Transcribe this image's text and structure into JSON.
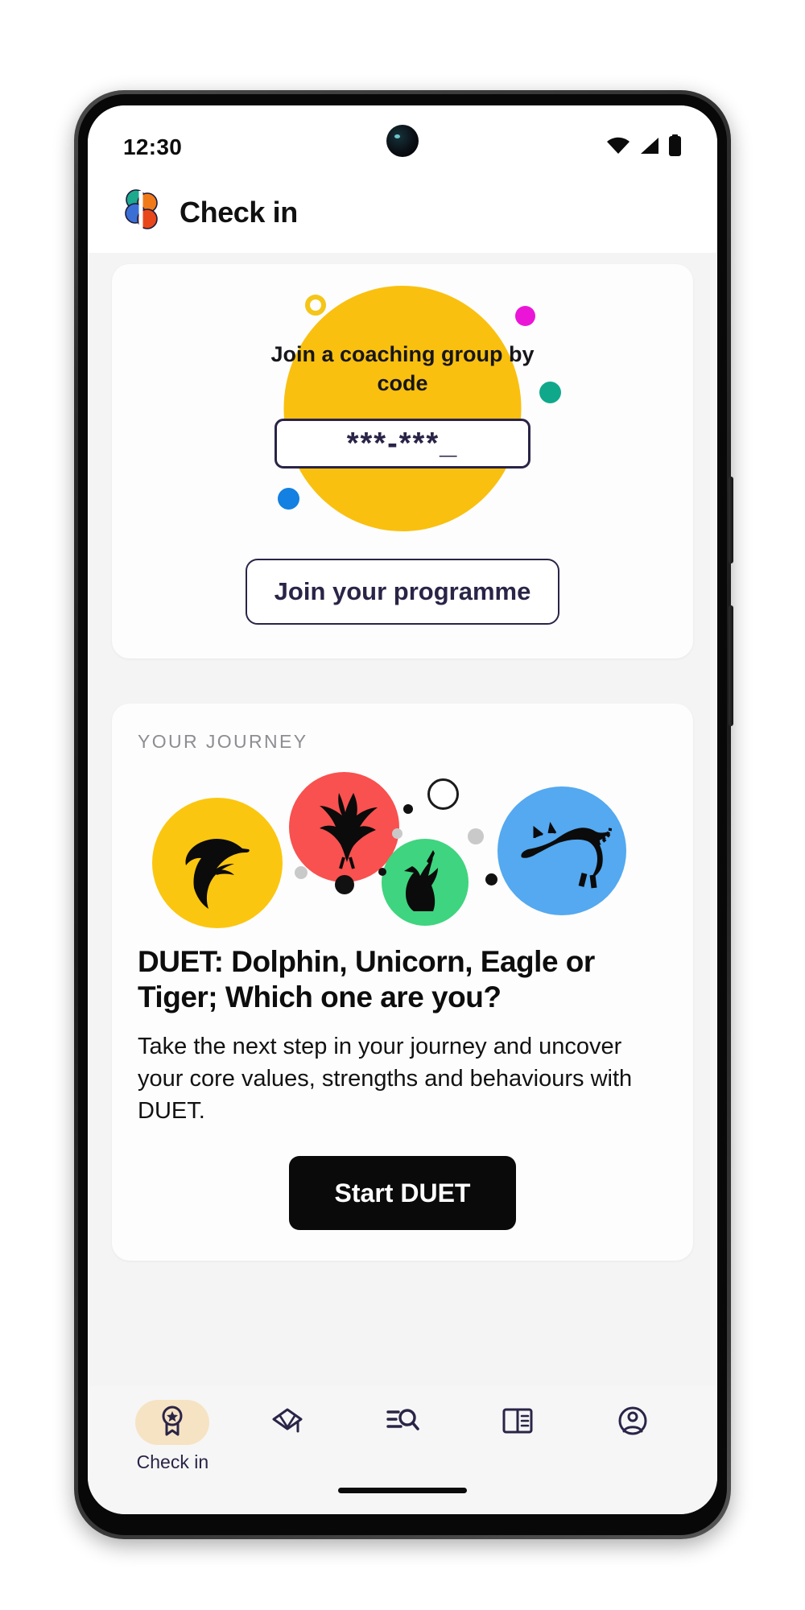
{
  "status_bar": {
    "time": "12:30",
    "icons": [
      "wifi-icon",
      "cellular-signal-icon",
      "battery-icon"
    ]
  },
  "header": {
    "title": "Check in",
    "logo": "app-logo-icon",
    "logo_colors": [
      "#1CA98D",
      "#F07A1A",
      "#3B6FD4",
      "#E8471C"
    ]
  },
  "join_card": {
    "blob_text": "Join a coaching group by code",
    "code_value": "***-***_",
    "code_placeholder": "***-***_",
    "button_label": "Join your programme",
    "blob_color": "#FAC00F",
    "decorations": [
      {
        "name": "deco-ring-yellow",
        "color": "#F5C518",
        "style": "ring"
      },
      {
        "name": "deco-dot-magenta",
        "color": "#EB15D8",
        "style": "solid"
      },
      {
        "name": "deco-dot-teal",
        "color": "#10A88B",
        "style": "solid"
      },
      {
        "name": "deco-dot-blue",
        "color": "#1380E2",
        "style": "solid"
      }
    ]
  },
  "journey_card": {
    "kicker": "YOUR JOURNEY",
    "title": "DUET: Dolphin, Unicorn, Eagle or Tiger; Which one are you?",
    "body": "Take the next step in your journey and uncover your core values, strengths and behaviours with DUET.",
    "button_label": "Start DUET",
    "animals": [
      {
        "name": "dolphin",
        "color": "#FBC60F"
      },
      {
        "name": "eagle",
        "color": "#F8514F"
      },
      {
        "name": "unicorn",
        "color": "#3FD47F"
      },
      {
        "name": "tiger",
        "color": "#54A9F0"
      }
    ]
  },
  "bottom_nav": {
    "items": [
      {
        "label": "Check in",
        "icon": "award-ribbon-icon",
        "active": true
      },
      {
        "label": "",
        "icon": "graduation-cap-icon",
        "active": false
      },
      {
        "label": "",
        "icon": "search-list-icon",
        "active": false
      },
      {
        "label": "",
        "icon": "book-reader-icon",
        "active": false
      },
      {
        "label": "",
        "icon": "profile-avatar-icon",
        "active": false
      }
    ],
    "active_pill_color": "#f6e3c3",
    "icon_color": "#2a2447"
  }
}
